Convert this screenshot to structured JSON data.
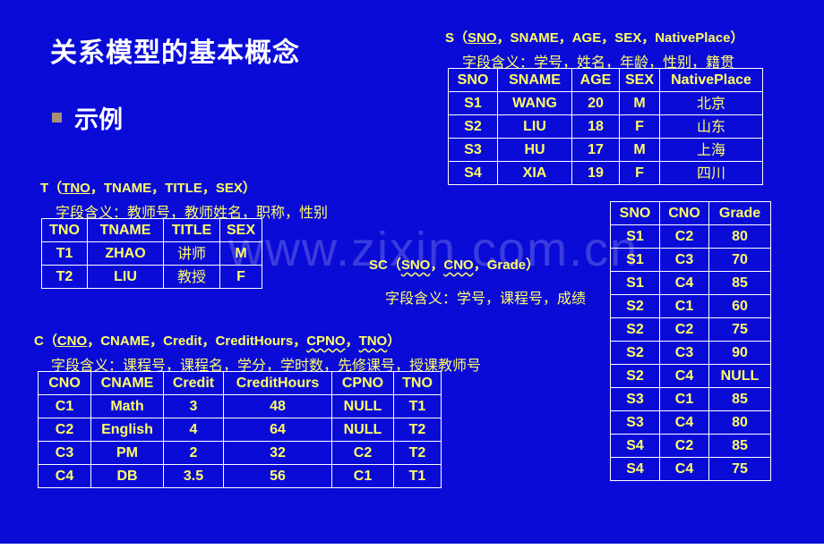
{
  "slide": {
    "title": "关系模型的基本概念",
    "bullet": "示例",
    "watermark": "www.zixin.com.cn"
  },
  "colors": {
    "background": "#0b0bd8",
    "text_yellow": "#ffff66",
    "title_white": "#ffffff",
    "bullet_square": "#a89070"
  },
  "S": {
    "schema_prefix": "S（",
    "key": "SNO",
    "schema_rest": "，SNAME，AGE，SEX，NativePlace）",
    "meaning": "字段含义：学号，姓名，年龄，性别，籍贯",
    "headers": [
      "SNO",
      "SNAME",
      "AGE",
      "SEX",
      "NativePlace"
    ],
    "rows": [
      [
        "S1",
        "WANG",
        "20",
        "M",
        "北京"
      ],
      [
        "S2",
        "LIU",
        "18",
        "F",
        "山东"
      ],
      [
        "S3",
        "HU",
        "17",
        "M",
        "上海"
      ],
      [
        "S4",
        "XIA",
        "19",
        "F",
        "四川"
      ]
    ]
  },
  "T": {
    "schema_prefix": "T（",
    "key": "TNO",
    "schema_rest": "，TNAME，TITLE，SEX）",
    "meaning": "字段含义：教师号，教师姓名，职称，性别",
    "headers": [
      "TNO",
      "TNAME",
      "TITLE",
      "SEX"
    ],
    "rows": [
      [
        "T1",
        "ZHAO",
        "讲师",
        "M"
      ],
      [
        "T2",
        "LIU",
        "教授",
        "F"
      ]
    ]
  },
  "SC": {
    "schema_prefix": "SC（",
    "key1": "SNO",
    "sep": "，",
    "key2": "CNO",
    "schema_rest": "，Grade）",
    "meaning": "字段含义：学号，课程号，成绩",
    "headers": [
      "SNO",
      "CNO",
      "Grade"
    ],
    "rows": [
      [
        "S1",
        "C2",
        "80"
      ],
      [
        "S1",
        "C3",
        "70"
      ],
      [
        "S1",
        "C4",
        "85"
      ],
      [
        "S2",
        "C1",
        "60"
      ],
      [
        "S2",
        "C2",
        "75"
      ],
      [
        "S2",
        "C3",
        "90"
      ],
      [
        "S2",
        "C4",
        "NULL"
      ],
      [
        "S3",
        "C1",
        "85"
      ],
      [
        "S3",
        "C4",
        "80"
      ],
      [
        "S4",
        "C2",
        "85"
      ],
      [
        "S4",
        "C4",
        "75"
      ]
    ]
  },
  "C": {
    "schema_prefix": "C（",
    "key": "CNO",
    "schema_mid": "，CNAME，Credit，CreditHours，",
    "fk1": "CPNO",
    "sep": "，",
    "fk2": "TNO",
    "schema_end": "）",
    "meaning": "字段含义：课程号，课程名，学分，学时数，先修课号，授课教师号",
    "headers": [
      "CNO",
      "CNAME",
      "Credit",
      "CreditHours",
      "CPNO",
      "TNO"
    ],
    "rows": [
      [
        "C1",
        "Math",
        "3",
        "48",
        "NULL",
        "T1"
      ],
      [
        "C2",
        "English",
        "4",
        "64",
        "NULL",
        "T2"
      ],
      [
        "C3",
        "PM",
        "2",
        "32",
        "C2",
        "T2"
      ],
      [
        "C4",
        "DB",
        "3.5",
        "56",
        "C1",
        "T1"
      ]
    ]
  }
}
